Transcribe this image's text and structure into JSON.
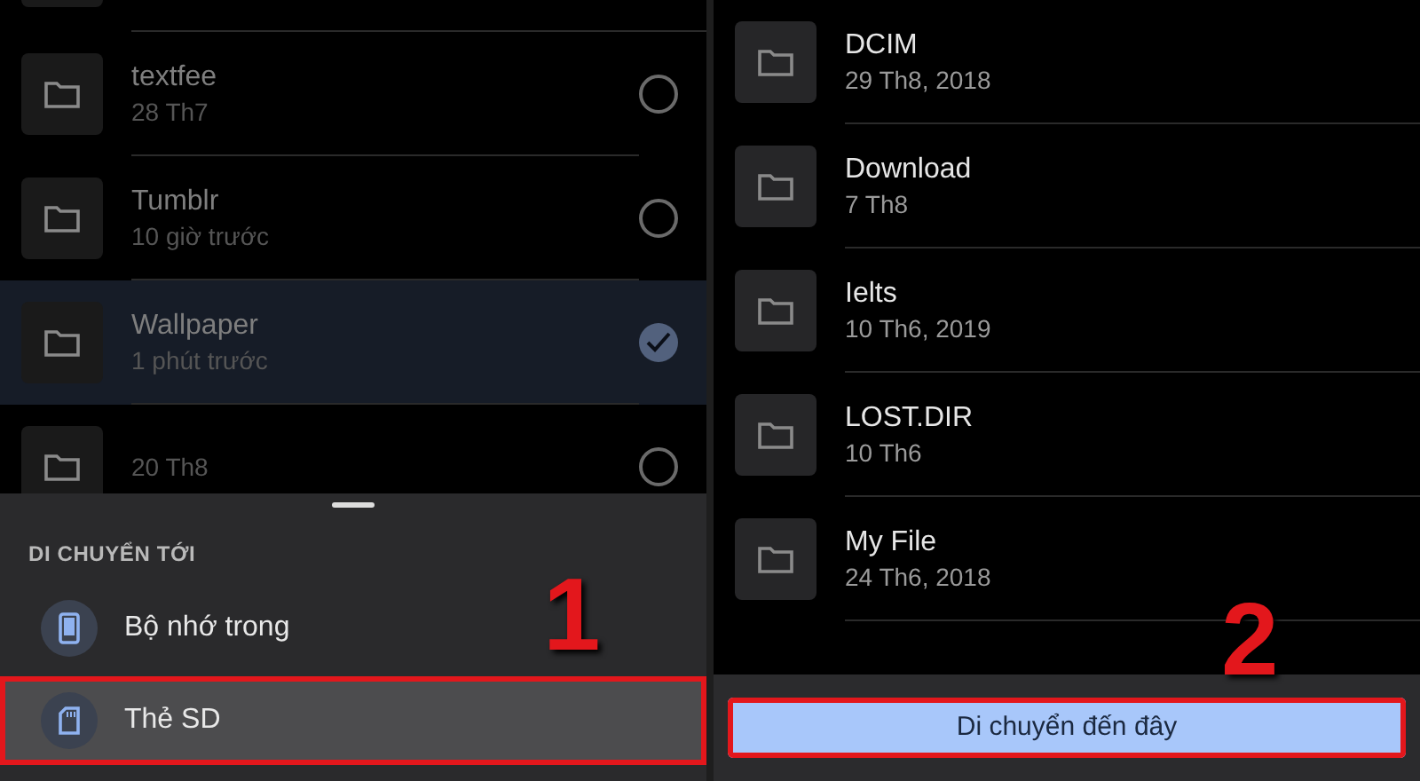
{
  "left_screen": {
    "files": [
      {
        "name": "textfee",
        "date": "28 Th7",
        "selected": false
      },
      {
        "name": "Tumblr",
        "date": "10 giờ trước",
        "selected": false
      },
      {
        "name": "Wallpaper",
        "date": "1 phút trước",
        "selected": true
      },
      {
        "date": "20 Th8",
        "selected": false
      }
    ],
    "move_sheet": {
      "title": "DI CHUYỂN TỚI",
      "destinations": [
        {
          "label": "Bộ nhớ trong",
          "kind": "phone",
          "selected": false,
          "annotated": false
        },
        {
          "label": "Thẻ SD",
          "kind": "sdcard",
          "selected": true,
          "annotated": true
        }
      ]
    },
    "step_marker": "1"
  },
  "right_screen": {
    "folders": [
      {
        "name": "DCIM",
        "date": "29 Th8, 2018"
      },
      {
        "name": "Download",
        "date": "7 Th8"
      },
      {
        "name": "Ielts",
        "date": "10 Th6, 2019"
      },
      {
        "name": "LOST.DIR",
        "date": "10 Th6"
      },
      {
        "name": "My File",
        "date": "24 Th6, 2018"
      }
    ],
    "move_button": {
      "label": "Di chuyển đến đây",
      "annotated": true
    },
    "step_marker": "2"
  }
}
